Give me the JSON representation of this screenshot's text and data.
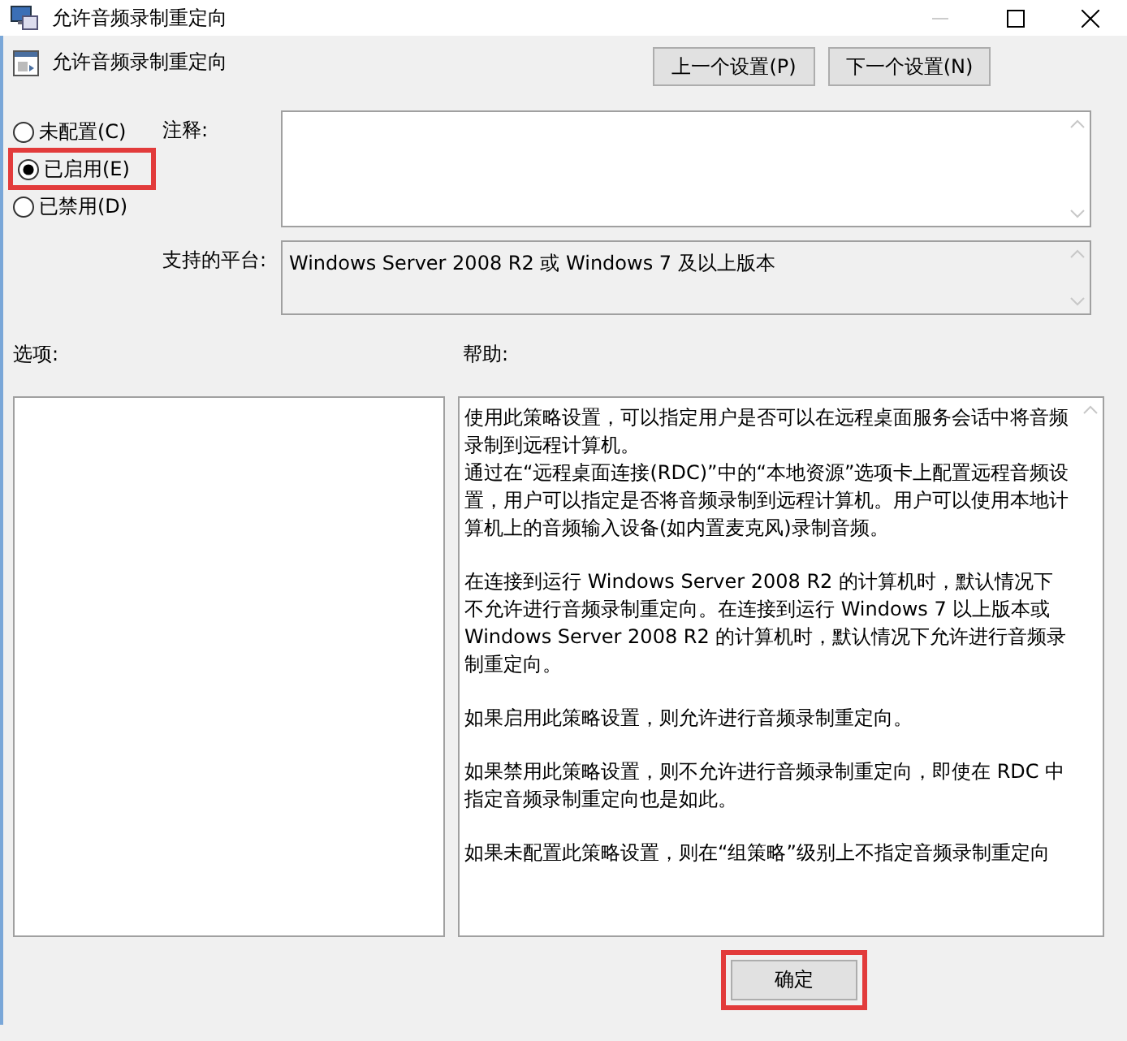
{
  "window": {
    "title": "允许音频录制重定向"
  },
  "header": {
    "title": "允许音频录制重定向"
  },
  "nav_buttons": [
    {
      "label": "上一个设置(P)"
    },
    {
      "label": "下一个设置(N)"
    }
  ],
  "states": [
    {
      "label": "未配置(C)",
      "selected": false,
      "highlighted": false
    },
    {
      "label": "已启用(E)",
      "selected": true,
      "highlighted": true
    },
    {
      "label": "已禁用(D)",
      "selected": false,
      "highlighted": false
    }
  ],
  "comment": {
    "label": "注释:"
  },
  "platform": {
    "label": "支持的平台:",
    "value": "Windows Server 2008 R2 或 Windows 7 及以上版本"
  },
  "options": {
    "label": "选项:"
  },
  "help": {
    "label": "帮助:",
    "paragraphs": [
      [
        "使用此策略设置，可以指定用户是否可以在远程桌面服务会话中将音频录制到远程计算机。",
        "通过在“远程桌面连接(RDC)”中的“本地资源”选项卡上配置远程音频设置，用户可以指定是否将音频录制到远程计算机。用户可以使用本地计算机上的音频输入设备(如内置麦克风)录制音频。"
      ],
      [
        "在连接到运行 Windows Server 2008 R2 的计算机时，默认情况下不允许进行音频录制重定向。在连接到运行 Windows 7 以上版本或 Windows Server 2008 R2 的计算机时，默认情况下允许进行音频录制重定向。"
      ],
      [
        "如果启用此策略设置，则允许进行音频录制重定向。"
      ],
      [
        "如果禁用此策略设置，则不允许进行音频录制重定向，即使在 RDC 中指定音频录制重定向也是如此。"
      ],
      [
        "如果未配置此策略设置，则在“组策略”级别上不指定音频录制重定向"
      ]
    ]
  },
  "ok_button": {
    "label": "确定",
    "highlighted": true
  }
}
